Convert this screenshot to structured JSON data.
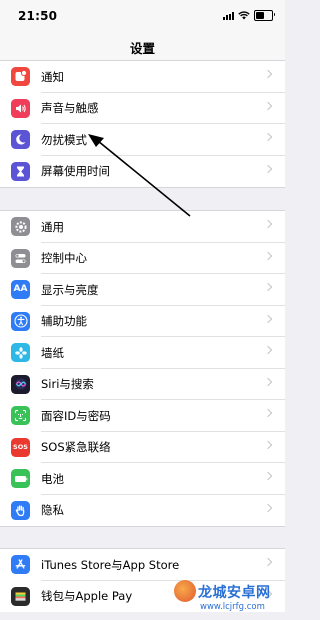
{
  "status_bar": {
    "time": "21:50"
  },
  "nav": {
    "title": "设置"
  },
  "groups": [
    [
      {
        "label": "通知",
        "icon": "notifications-icon",
        "color": "#f0483e"
      },
      {
        "label": "声音与触感",
        "icon": "speaker-icon",
        "color": "#f03d5a"
      },
      {
        "label": "勿扰模式",
        "icon": "moon-icon",
        "color": "#5b55d6"
      },
      {
        "label": "屏幕使用时间",
        "icon": "hourglass-icon",
        "color": "#5b55d6"
      }
    ],
    [
      {
        "label": "通用",
        "icon": "gear-icon",
        "color": "#8e8e93"
      },
      {
        "label": "控制中心",
        "icon": "control-center-icon",
        "color": "#8e8e93"
      },
      {
        "label": "显示与亮度",
        "icon": "display-icon",
        "color": "#2f7cf6",
        "glyph": "AA"
      },
      {
        "label": "辅助功能",
        "icon": "accessibility-icon",
        "color": "#2f7cf6"
      },
      {
        "label": "墙纸",
        "icon": "wallpaper-icon",
        "color": "#2fb8e6"
      },
      {
        "label": "Siri与搜索",
        "icon": "siri-icon",
        "color": "#1c1c2e"
      },
      {
        "label": "面容ID与密码",
        "icon": "face-id-icon",
        "color": "#39c257"
      },
      {
        "label": "SOS紧急联络",
        "icon": "sos-icon",
        "color": "#ea3a2f",
        "glyph": "SOS"
      },
      {
        "label": "电池",
        "icon": "battery-icon",
        "color": "#39c257"
      },
      {
        "label": "隐私",
        "icon": "hand-icon",
        "color": "#2f7cf6"
      }
    ],
    [
      {
        "label": "iTunes Store与App Store",
        "icon": "app-store-icon",
        "color": "#2f7cf6"
      },
      {
        "label": "钱包与Apple Pay",
        "icon": "wallet-icon",
        "color": "#2b2b2b"
      }
    ]
  ],
  "watermark": {
    "title": "龙城安卓网",
    "url": "www.lcjrfg.com"
  }
}
